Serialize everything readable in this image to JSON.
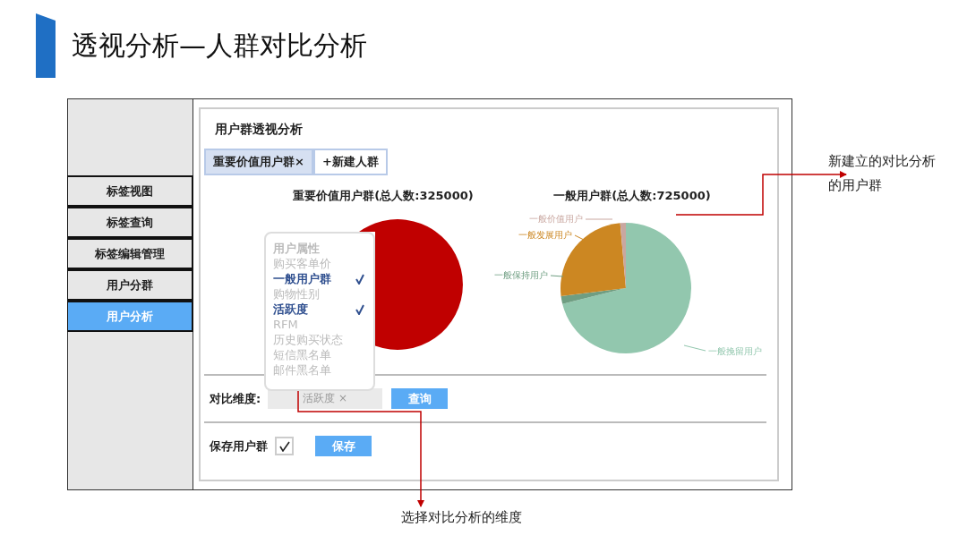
{
  "slide_title": "透视分析—人群对比分析",
  "sidebar": {
    "items": [
      {
        "label": "标签视图",
        "selected": false
      },
      {
        "label": "标签查询",
        "selected": false
      },
      {
        "label": "标签编辑管理",
        "selected": false
      },
      {
        "label": "用户分群",
        "selected": false
      },
      {
        "label": "用户分析",
        "selected": true
      }
    ]
  },
  "panel": {
    "title": "用户群透视分析",
    "tabs": [
      {
        "label": "重要价值用户群×",
        "selected": true
      },
      {
        "label": "+新建人群",
        "selected": false
      }
    ],
    "charts": [
      {
        "title": "重要价值用户群(总人数:325000)"
      },
      {
        "title": "一般用户群(总人数:725000)",
        "slice_labels": [
          "一般价值用户",
          "一般发展用户",
          "一般保持用户",
          "一般挽留用户"
        ]
      }
    ],
    "compare": {
      "label": "对比维度:",
      "value": "活跃度 ×",
      "button": "查询"
    },
    "save": {
      "label": "保存用户群",
      "checked": true,
      "button": "保存"
    }
  },
  "dropdown": {
    "header": "用户属性",
    "items": [
      {
        "label": "购买客单价",
        "selected": false
      },
      {
        "label": "一般用户群",
        "selected": true
      },
      {
        "label": "购物性别",
        "selected": false
      },
      {
        "label": "活跃度",
        "selected": true
      },
      {
        "label": "RFM",
        "selected": false
      },
      {
        "label": "历史购买状态",
        "selected": false
      },
      {
        "label": "短信黑名单",
        "selected": false
      },
      {
        "label": "邮件黑名单",
        "selected": false
      }
    ]
  },
  "annotations": [
    {
      "text": "新建立的对比分析的用户群"
    },
    {
      "text": "选择对比分析的维度"
    }
  ]
}
